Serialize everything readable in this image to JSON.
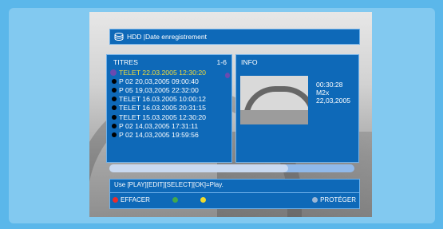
{
  "header": {
    "title": "HDD |Date enregistrement",
    "icon": "hdd-icon"
  },
  "list": {
    "title": "TITRES",
    "count": "1-6",
    "items": [
      "TELET 22.03.2005 12:30:20",
      "P 02 20,03,2005 09:00:40",
      "P 05 19,03,2005 22:32:00",
      "TELET 16.03.2005 10:00:12",
      "TELET 16.03.2005 20:31:15",
      "TELET 15.03.2005 12:30:20",
      "P 02 14,03,2005 17:31:11",
      "P 02 14,03,2005 19:59:56"
    ],
    "selected_index": 0
  },
  "info": {
    "title": "INFO",
    "duration": "00:30:28",
    "channel": "M2x",
    "date": "22,03,2005"
  },
  "progress": {
    "fraction": 0.73
  },
  "help": {
    "text": "Use [PLAY][EDIT][SELECT][OK]=Play."
  },
  "legend": {
    "red": "EFFACER",
    "blue": "PROTÉGER"
  },
  "colors": {
    "background": "#5bb7ea",
    "panel": "#0e69b8",
    "selected_text": "#f0dc3b",
    "red": "#ea2c2c",
    "green": "#43a84c",
    "yellow": "#f1da2b",
    "blue": "#9bb7d6"
  }
}
